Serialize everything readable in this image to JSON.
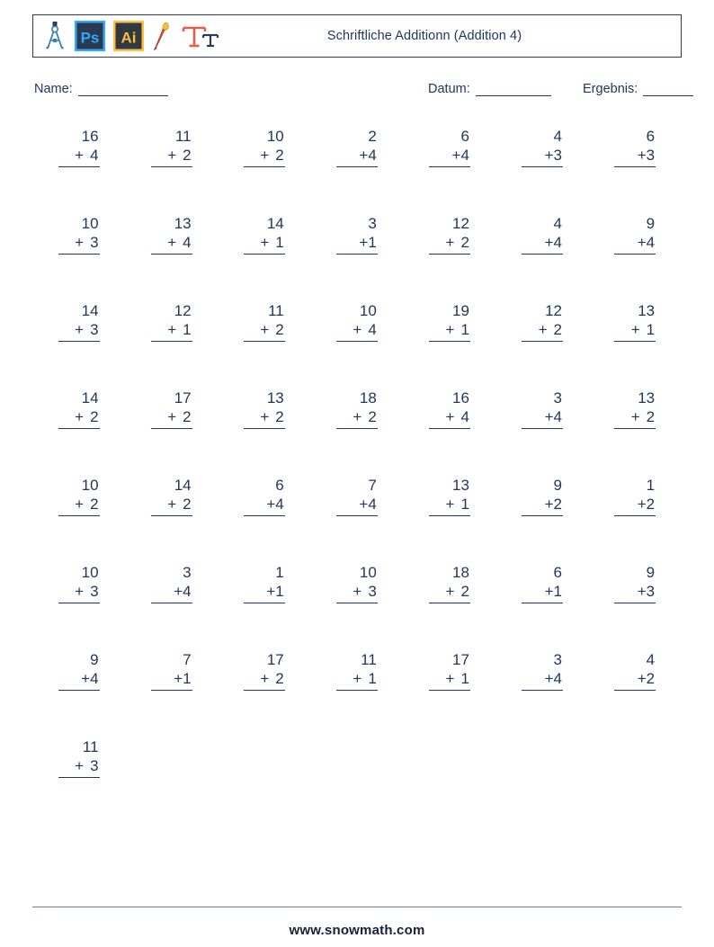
{
  "header": {
    "title": "Schriftliche Additionn (Addition 4)",
    "icons": [
      {
        "name": "compass-icon",
        "label": "compass"
      },
      {
        "name": "photoshop-icon",
        "label": "Ps"
      },
      {
        "name": "illustrator-icon",
        "label": "Ai"
      },
      {
        "name": "paintbrush-icon",
        "label": "brush"
      },
      {
        "name": "text-tool-icon",
        "label": "Tt"
      }
    ]
  },
  "meta": {
    "name_label": "Name:",
    "datum_label": "Datum:",
    "ergebnis_label": "Ergebnis:",
    "name_value": "",
    "datum_value": "",
    "ergebnis_value": ""
  },
  "footer": {
    "site": "www.snowmath.com"
  },
  "colors": {
    "text": "#20375e",
    "border": "#2b3a5b",
    "ps_blue": "#31a8ff",
    "ps_dark": "#2b3a4f",
    "ai_orange": "#ffbf45",
    "ai_dark": "#31383f",
    "brush_red": "#e0604b",
    "footer": "#15203a"
  },
  "worksheet": {
    "operator": "+",
    "columns": 7,
    "rows": 8,
    "problems": [
      [
        {
          "top": "16",
          "op": "+",
          "addend": "4",
          "spaced": true
        },
        {
          "top": "11",
          "op": "+",
          "addend": "2",
          "spaced": true
        },
        {
          "top": "10",
          "op": "+",
          "addend": "2",
          "spaced": true
        },
        {
          "top": "2",
          "op": "+",
          "addend": "4",
          "spaced": false
        },
        {
          "top": "6",
          "op": "+",
          "addend": "4",
          "spaced": false
        },
        {
          "top": "4",
          "op": "+",
          "addend": "3",
          "spaced": false
        },
        {
          "top": "6",
          "op": "+",
          "addend": "3",
          "spaced": false
        }
      ],
      [
        {
          "top": "10",
          "op": "+",
          "addend": "3",
          "spaced": true
        },
        {
          "top": "13",
          "op": "+",
          "addend": "4",
          "spaced": true
        },
        {
          "top": "14",
          "op": "+",
          "addend": "1",
          "spaced": true
        },
        {
          "top": "3",
          "op": "+",
          "addend": "1",
          "spaced": false
        },
        {
          "top": "12",
          "op": "+",
          "addend": "2",
          "spaced": true
        },
        {
          "top": "4",
          "op": "+",
          "addend": "4",
          "spaced": false
        },
        {
          "top": "9",
          "op": "+",
          "addend": "4",
          "spaced": false
        }
      ],
      [
        {
          "top": "14",
          "op": "+",
          "addend": "3",
          "spaced": true
        },
        {
          "top": "12",
          "op": "+",
          "addend": "1",
          "spaced": true
        },
        {
          "top": "11",
          "op": "+",
          "addend": "2",
          "spaced": true
        },
        {
          "top": "10",
          "op": "+",
          "addend": "4",
          "spaced": true
        },
        {
          "top": "19",
          "op": "+",
          "addend": "1",
          "spaced": true
        },
        {
          "top": "12",
          "op": "+",
          "addend": "2",
          "spaced": true
        },
        {
          "top": "13",
          "op": "+",
          "addend": "1",
          "spaced": true
        }
      ],
      [
        {
          "top": "14",
          "op": "+",
          "addend": "2",
          "spaced": true
        },
        {
          "top": "17",
          "op": "+",
          "addend": "2",
          "spaced": true
        },
        {
          "top": "13",
          "op": "+",
          "addend": "2",
          "spaced": true
        },
        {
          "top": "18",
          "op": "+",
          "addend": "2",
          "spaced": true
        },
        {
          "top": "16",
          "op": "+",
          "addend": "4",
          "spaced": true
        },
        {
          "top": "3",
          "op": "+",
          "addend": "4",
          "spaced": false
        },
        {
          "top": "13",
          "op": "+",
          "addend": "2",
          "spaced": true
        }
      ],
      [
        {
          "top": "10",
          "op": "+",
          "addend": "2",
          "spaced": true
        },
        {
          "top": "14",
          "op": "+",
          "addend": "2",
          "spaced": true
        },
        {
          "top": "6",
          "op": "+",
          "addend": "4",
          "spaced": false
        },
        {
          "top": "7",
          "op": "+",
          "addend": "4",
          "spaced": false
        },
        {
          "top": "13",
          "op": "+",
          "addend": "1",
          "spaced": true
        },
        {
          "top": "9",
          "op": "+",
          "addend": "2",
          "spaced": false
        },
        {
          "top": "1",
          "op": "+",
          "addend": "2",
          "spaced": false
        }
      ],
      [
        {
          "top": "10",
          "op": "+",
          "addend": "3",
          "spaced": true
        },
        {
          "top": "3",
          "op": "+",
          "addend": "4",
          "spaced": false
        },
        {
          "top": "1",
          "op": "+",
          "addend": "1",
          "spaced": false
        },
        {
          "top": "10",
          "op": "+",
          "addend": "3",
          "spaced": true
        },
        {
          "top": "18",
          "op": "+",
          "addend": "2",
          "spaced": true
        },
        {
          "top": "6",
          "op": "+",
          "addend": "1",
          "spaced": false
        },
        {
          "top": "9",
          "op": "+",
          "addend": "3",
          "spaced": false
        }
      ],
      [
        {
          "top": "9",
          "op": "+",
          "addend": "4",
          "spaced": false
        },
        {
          "top": "7",
          "op": "+",
          "addend": "1",
          "spaced": false
        },
        {
          "top": "17",
          "op": "+",
          "addend": "2",
          "spaced": true
        },
        {
          "top": "11",
          "op": "+",
          "addend": "1",
          "spaced": true
        },
        {
          "top": "17",
          "op": "+",
          "addend": "1",
          "spaced": true
        },
        {
          "top": "3",
          "op": "+",
          "addend": "4",
          "spaced": false
        },
        {
          "top": "4",
          "op": "+",
          "addend": "2",
          "spaced": false
        }
      ],
      [
        {
          "top": "11",
          "op": "+",
          "addend": "3",
          "spaced": true
        }
      ]
    ]
  }
}
